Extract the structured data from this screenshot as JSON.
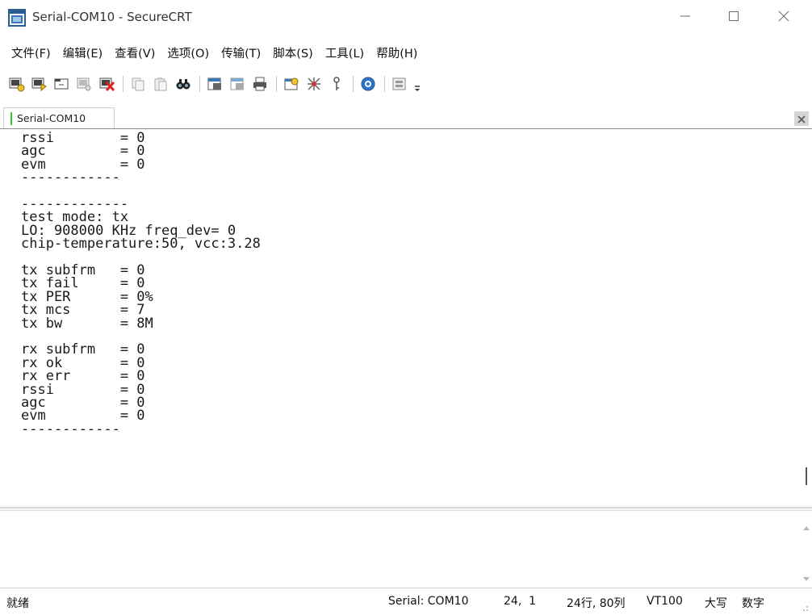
{
  "window": {
    "title": "Serial-COM10 - SecureCRT",
    "min_icon": "minimize-icon",
    "max_icon": "maximize-icon",
    "close_icon": "close-icon"
  },
  "menu": [
    {
      "label": "文件(F)"
    },
    {
      "label": "编辑(E)"
    },
    {
      "label": "查看(V)"
    },
    {
      "label": "选项(O)"
    },
    {
      "label": "传输(T)"
    },
    {
      "label": "脚本(S)"
    },
    {
      "label": "工具(L)"
    },
    {
      "label": "帮助(H)"
    }
  ],
  "toolbar_icons": [
    "connect-icon",
    "quick-connect-icon",
    "connect-tab-icon",
    "reconnect-icon",
    "disconnect-icon",
    "copy-icon",
    "paste-icon",
    "find-icon",
    "print-icon",
    "print-selection-icon",
    "printer-icon",
    "session-options-icon",
    "global-options-icon",
    "keymap-icon",
    "help-icon",
    "sftp-icon",
    "toolbar-overflow-icon"
  ],
  "tab": {
    "label": "Serial-COM10",
    "active_color": "#2ecc2e"
  },
  "terminal": {
    "lines": [
      "rssi        = 0",
      "agc         = 0",
      "evm         = 0",
      "------------",
      "",
      "-------------",
      "test mode: tx",
      "LO: 908000 KHz freq_dev= 0",
      "chip-temperature:50, vcc:3.28",
      "",
      "tx subfrm   = 0",
      "tx fail     = 0",
      "tx PER      = 0%",
      "tx mcs      = 7",
      "tx bw       = 8M",
      "",
      "rx subfrm   = 0",
      "rx ok       = 0",
      "rx err      = 0",
      "rssi        = 0",
      "agc         = 0",
      "evm         = 0",
      "------------"
    ]
  },
  "status": {
    "ready": "就绪",
    "connection": "Serial: COM10",
    "cursor": "24,  1",
    "size": "24行, 80列",
    "emulation": "VT100",
    "caps": "大写",
    "num": "数字"
  },
  "colors": {
    "tab_marker": "#2ecc2e",
    "background": "#ffffff"
  }
}
